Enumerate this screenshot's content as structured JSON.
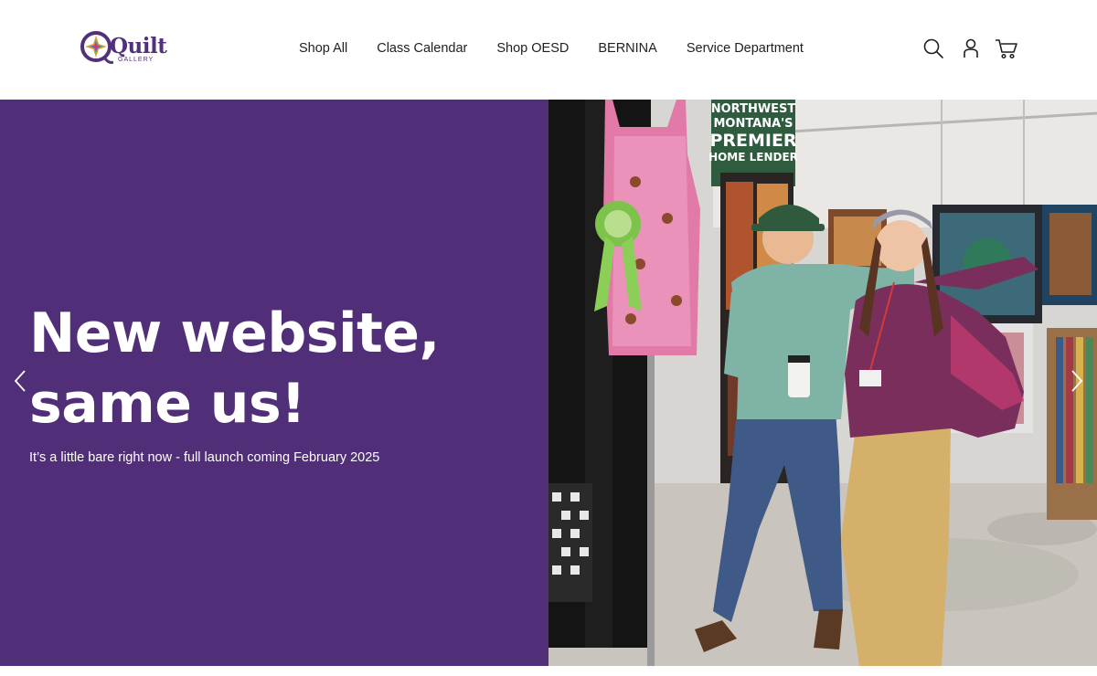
{
  "header": {
    "logo": {
      "word": "Quilt",
      "sub": "GALLERY",
      "icon": "quilt-star-logo",
      "brand_color": "#53307a"
    },
    "nav": [
      {
        "label": "Shop All"
      },
      {
        "label": "Class Calendar"
      },
      {
        "label": "Shop OESD"
      },
      {
        "label": "BERNINA"
      },
      {
        "label": "Service Department"
      }
    ],
    "icons": {
      "search": "search-icon",
      "account": "account-icon",
      "cart": "cart-icon"
    }
  },
  "hero": {
    "title_line1": "New website,",
    "title_line2": "same us!",
    "subtitle": "It’s a little bare right now - full launch coming February 2025",
    "background_color": "#512f78",
    "banner_lines": [
      "NORTHWEST",
      "MONTANA'S",
      "PREMIER",
      "HOME LENDER"
    ],
    "arrows": {
      "prev": "chevron-left-icon",
      "next": "chevron-right-icon"
    }
  }
}
